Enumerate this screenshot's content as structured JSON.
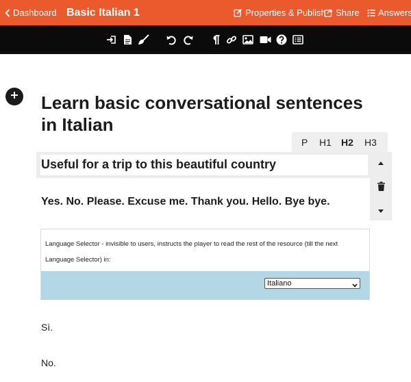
{
  "topbar": {
    "back_label": "Dashboard",
    "title": "Basic Italian 1",
    "properties_label": "Properties & Publish",
    "share_label": "Share",
    "answers_label": "Answers",
    "color": "#ea5a2d"
  },
  "toolbar": {
    "icons": [
      "import-icon",
      "document-icon",
      "clear-format-icon",
      "undo-icon",
      "redo-icon",
      "paragraph-icon",
      "link-icon",
      "image-icon",
      "video-icon",
      "help-icon",
      "list-icon"
    ]
  },
  "content": {
    "heading1": "Learn basic conversational sentences in Italian",
    "heading2": "Useful for a trip to this beautiful country",
    "heading3": "Yes. No. Please. Excuse me. Thank you. Hello. Bye bye.",
    "level_options": [
      "P",
      "H1",
      "H2",
      "H3"
    ],
    "selected_level": "H2",
    "language_selector": {
      "description": "Language Selector - invisible to users, instructs the player to read the rest of the resource (till the next Language Selector) in:",
      "selected_value": "Italiano"
    },
    "paragraphs": [
      "Sì.",
      "No."
    ]
  }
}
